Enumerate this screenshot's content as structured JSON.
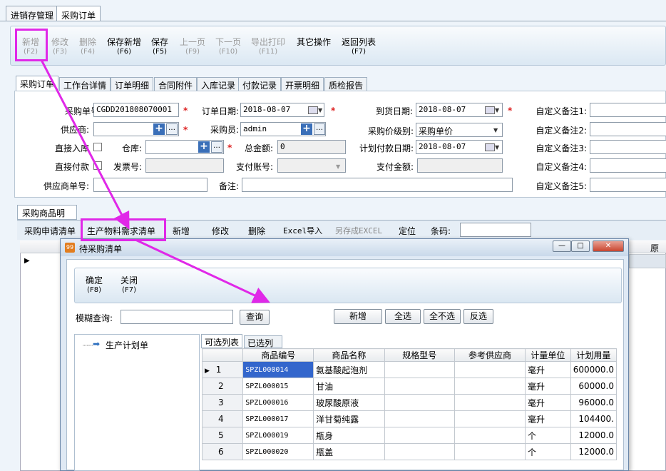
{
  "top_tabs": [
    "进销存管理",
    "采购订单"
  ],
  "toolbar": [
    {
      "label": "新增",
      "key": "(F2)",
      "enabled": false
    },
    {
      "label": "修改",
      "key": "(F3)",
      "enabled": false
    },
    {
      "label": "删除",
      "key": "(F4)",
      "enabled": false
    },
    {
      "label": "保存新增",
      "key": "(F6)",
      "enabled": true
    },
    {
      "label": "保存",
      "key": "(F5)",
      "enabled": true
    },
    {
      "label": "上一页",
      "key": "(F9)",
      "enabled": false
    },
    {
      "label": "下一页",
      "key": "(F10)",
      "enabled": false
    },
    {
      "label": "导出打印",
      "key": "(F11)",
      "enabled": false
    },
    {
      "label": "其它操作",
      "key": "",
      "enabled": true
    },
    {
      "label": "返回列表",
      "key": "(F7)",
      "enabled": true
    }
  ],
  "sub_tabs": [
    "采购订单",
    "工作台详情",
    "订单明细",
    "合同附件",
    "入库记录",
    "付款记录",
    "开票明细",
    "质检报告"
  ],
  "form": {
    "order_no_label": "采购单号:",
    "order_no": "CGDD201808070001",
    "order_date_label": "订单日期:",
    "order_date": "2018-08-07",
    "arrival_date_label": "到货日期:",
    "arrival_date": "2018-08-07",
    "supplier_label": "供应商:",
    "supplier": "",
    "buyer_label": "采购员:",
    "buyer": "admin",
    "price_level_label": "采购价级别:",
    "price_level": "采购单价",
    "direct_in_label": "直接入库",
    "warehouse_label": "仓库:",
    "warehouse": "",
    "total_label": "总金额:",
    "total": "0",
    "plan_pay_date_label": "计划付款日期:",
    "plan_pay_date": "2018-08-07",
    "direct_pay_label": "直接付款",
    "invoice_label": "发票号:",
    "invoice": "",
    "pay_account_label": "支付账号:",
    "pay_account": "",
    "pay_amount_label": "支付金额:",
    "pay_amount": "",
    "supplier_no_label": "供应商单号:",
    "supplier_no": "",
    "remark_label": "备注:",
    "remark": "",
    "custom": [
      "自定义备注1:",
      "自定义备注2:",
      "自定义备注3:",
      "自定义备注4:",
      "自定义备注5:"
    ]
  },
  "detail_tab": "采购商品明细",
  "detail_toolbar": [
    "采购申请清单",
    "生产物料需求清单",
    "新增",
    "修改",
    "删除",
    "Excel导入",
    "另存成EXCEL",
    "定位",
    "条码:"
  ],
  "grid_right_header": "原价",
  "dialog": {
    "icon": "99",
    "title": "待采购清单",
    "confirm": {
      "label": "确定",
      "key": "(F8)"
    },
    "close": {
      "label": "关闭",
      "key": "(F7)"
    },
    "search_label": "模糊查询:",
    "search_value": "",
    "search_btn": "查询",
    "add_btn": "新增",
    "select_all": "全选",
    "select_none": "全不选",
    "invert": "反选",
    "tree_root": "生产计划单",
    "list_tabs": [
      "可选列表",
      "已选列表"
    ],
    "columns": [
      "",
      "商品编号",
      "商品名称",
      "规格型号",
      "参考供应商",
      "计量单位",
      "计划用量"
    ],
    "rows": [
      {
        "no": "1",
        "code": "SPZL000014",
        "name": "氨基酸起泡剂",
        "spec": "",
        "supplier": "",
        "unit": "毫升",
        "qty": "600000.0"
      },
      {
        "no": "2",
        "code": "SPZL000015",
        "name": "甘油",
        "spec": "",
        "supplier": "",
        "unit": "毫升",
        "qty": "60000.0"
      },
      {
        "no": "3",
        "code": "SPZL000016",
        "name": "玻尿酸原液",
        "spec": "",
        "supplier": "",
        "unit": "毫升",
        "qty": "96000.0"
      },
      {
        "no": "4",
        "code": "SPZL000017",
        "name": "洋甘菊纯露",
        "spec": "",
        "supplier": "",
        "unit": "毫升",
        "qty": "104400."
      },
      {
        "no": "5",
        "code": "SPZL000019",
        "name": "瓶身",
        "spec": "",
        "supplier": "",
        "unit": "个",
        "qty": "12000.0"
      },
      {
        "no": "6",
        "code": "SPZL000020",
        "name": "瓶盖",
        "spec": "",
        "supplier": "",
        "unit": "个",
        "qty": "12000.0"
      }
    ]
  },
  "colors": {
    "highlight": "#e028e8",
    "required": "#d22222",
    "selected_cell": "#3366cc"
  }
}
